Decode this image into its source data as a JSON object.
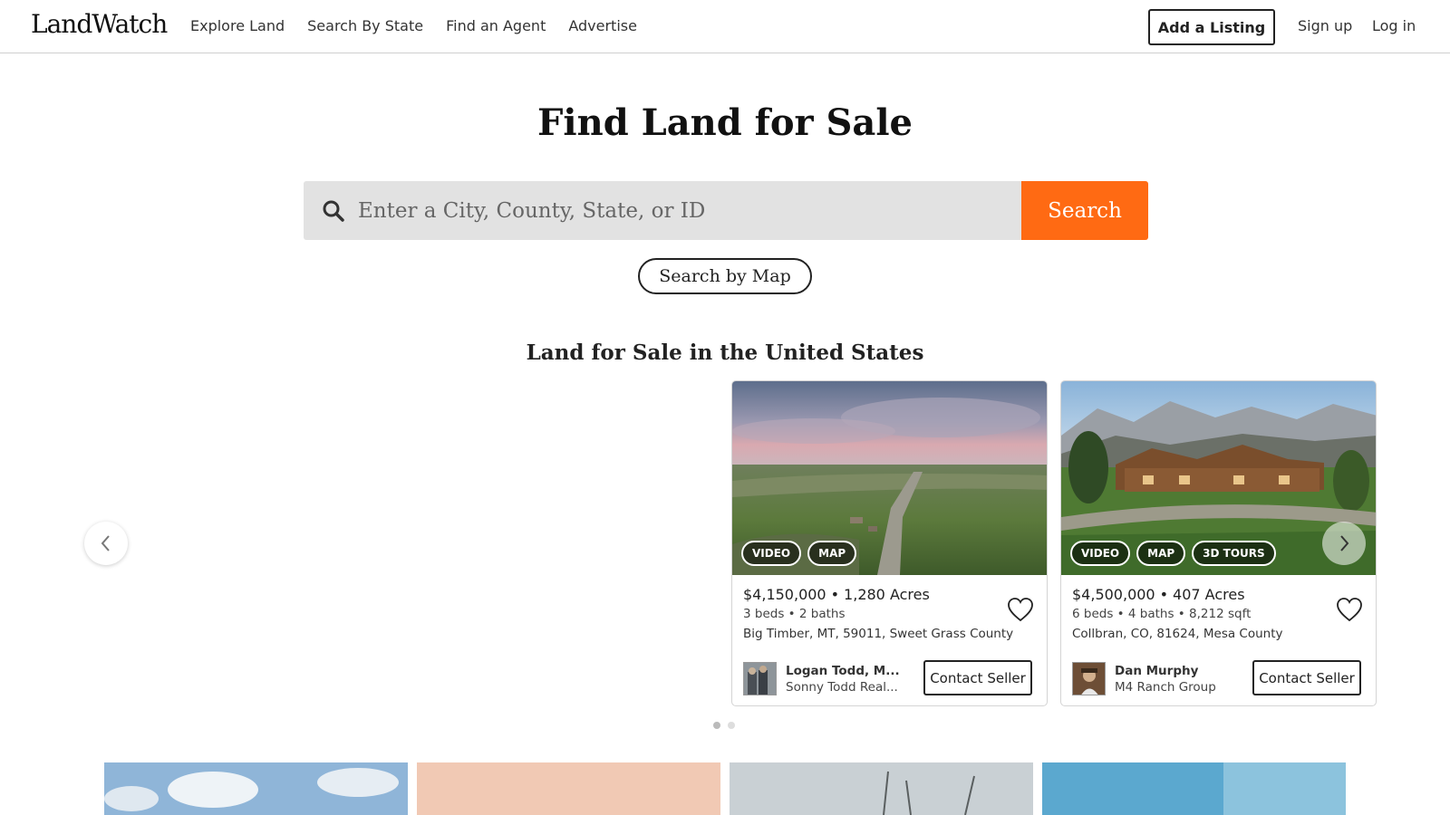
{
  "header": {
    "logo": "LandWatch",
    "nav": [
      "Explore Land",
      "Search By State",
      "Find an Agent",
      "Advertise"
    ],
    "add_listing": "Add a Listing",
    "sign_up": "Sign up",
    "log_in": "Log in"
  },
  "hero": {
    "title": "Find Land for Sale",
    "search_placeholder": "Enter a City, County, State, or ID",
    "search_button": "Search",
    "map_button": "Search by Map"
  },
  "section_title": "Land for Sale in the United States",
  "listings": [
    {
      "price": "$4,150,000",
      "acres": "1,280 Acres",
      "details": "3 beds • 2 baths",
      "address": "Big Timber, MT, 59011, Sweet Grass County",
      "tags": [
        "VIDEO",
        "MAP"
      ],
      "agent_name": "Logan Todd, M...",
      "agent_company": "Sonny Todd Real...",
      "contact": "Contact Seller"
    },
    {
      "price": "$4,500,000",
      "acres": "407 Acres",
      "details": "6 beds • 4 baths • 8,212 sqft",
      "address": "Collbran, CO, 81624, Mesa County",
      "tags": [
        "VIDEO",
        "MAP",
        "3D TOURS"
      ],
      "agent_name": "Dan Murphy",
      "agent_company": "M4 Ranch Group",
      "contact": "Contact Seller"
    }
  ],
  "colors": {
    "accent": "#ff6a13",
    "search_bg": "#e2e2e2"
  },
  "icons": {
    "search": "search-icon",
    "prev": "chevron-left-icon",
    "next": "chevron-right-icon",
    "favorite": "heart-icon"
  }
}
